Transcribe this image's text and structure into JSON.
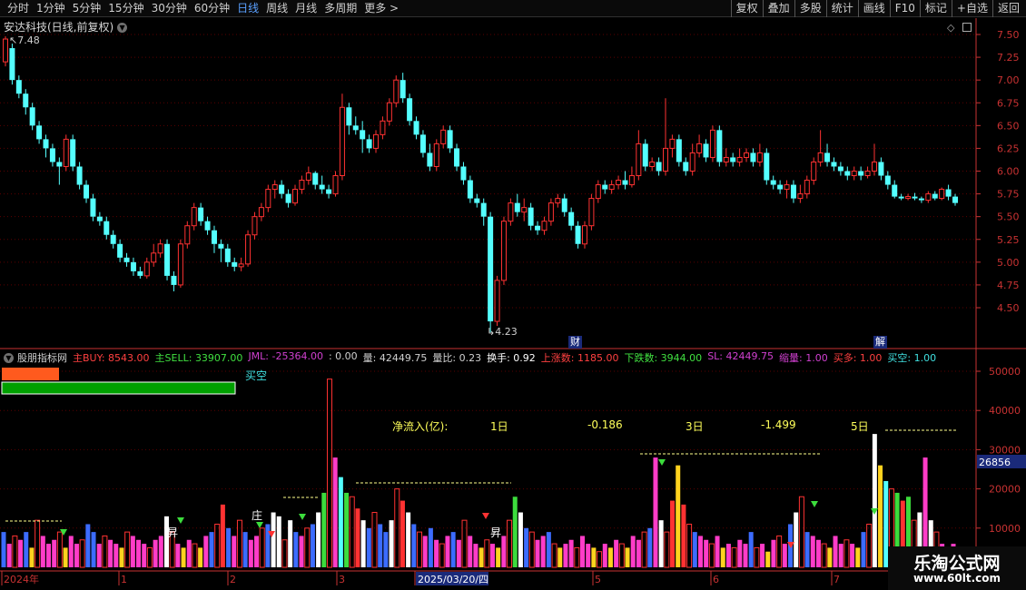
{
  "toolbar": {
    "left_items": [
      "分时",
      "1分钟",
      "5分钟",
      "15分钟",
      "30分钟",
      "60分钟",
      "日线",
      "周线",
      "月线",
      "多周期",
      "更多 >"
    ],
    "active_index": 6,
    "right_items": [
      "复权",
      "叠加",
      "多股",
      "统计",
      "画线",
      "F10",
      "标记",
      "+自选",
      "返回"
    ]
  },
  "main_chart": {
    "title": "安达科技(日线,前复权)",
    "high_label": "7.48",
    "low_label": "4.23",
    "events": [
      {
        "label": "财"
      },
      {
        "label": "解"
      }
    ],
    "price_axis": [
      "7.50",
      "7.25",
      "7.00",
      "6.75",
      "6.50",
      "6.25",
      "6.00",
      "5.75",
      "5.50",
      "5.25",
      "5.00",
      "4.75",
      "4.50"
    ],
    "candles": [
      [
        7.2,
        7.45,
        7.15,
        7.48
      ],
      [
        7.35,
        7.0,
        6.95,
        7.4
      ],
      [
        7.0,
        6.85,
        6.8,
        7.05
      ],
      [
        6.85,
        6.7,
        6.62,
        6.9
      ],
      [
        6.7,
        6.5,
        6.45,
        6.75
      ],
      [
        6.5,
        6.35,
        6.3,
        6.55
      ],
      [
        6.35,
        6.25,
        6.15,
        6.4
      ],
      [
        6.25,
        6.1,
        6.05,
        6.3
      ],
      [
        6.1,
        6.05,
        5.85,
        6.15
      ],
      [
        6.05,
        6.35,
        6.0,
        6.4
      ],
      [
        6.35,
        6.05,
        6.0,
        6.4
      ],
      [
        6.05,
        5.85,
        5.8,
        6.1
      ],
      [
        5.85,
        5.7,
        5.65,
        5.9
      ],
      [
        5.7,
        5.5,
        5.45,
        5.75
      ],
      [
        5.5,
        5.45,
        5.4,
        5.55
      ],
      [
        5.45,
        5.3,
        5.25,
        5.5
      ],
      [
        5.3,
        5.2,
        5.15,
        5.35
      ],
      [
        5.2,
        5.05,
        5.0,
        5.25
      ],
      [
        5.05,
        5.0,
        4.95,
        5.1
      ],
      [
        5.0,
        4.9,
        4.85,
        5.05
      ],
      [
        4.9,
        4.85,
        4.82,
        4.95
      ],
      [
        4.85,
        5.0,
        4.82,
        5.05
      ],
      [
        5.0,
        5.1,
        4.95,
        5.2
      ],
      [
        5.1,
        5.2,
        5.05,
        5.25
      ],
      [
        5.2,
        4.85,
        4.8,
        5.25
      ],
      [
        4.85,
        4.75,
        4.68,
        4.9
      ],
      [
        4.75,
        5.2,
        4.72,
        5.25
      ],
      [
        5.2,
        5.4,
        5.15,
        5.45
      ],
      [
        5.4,
        5.6,
        5.35,
        5.65
      ],
      [
        5.6,
        5.45,
        5.4,
        5.65
      ],
      [
        5.45,
        5.35,
        5.3,
        5.5
      ],
      [
        5.35,
        5.2,
        5.1,
        5.4
      ],
      [
        5.2,
        5.15,
        5.0,
        5.25
      ],
      [
        5.15,
        5.0,
        4.95,
        5.2
      ],
      [
        5.0,
        4.95,
        4.9,
        5.05
      ],
      [
        4.95,
        4.98,
        4.9,
        5.05
      ],
      [
        4.98,
        5.3,
        4.95,
        5.35
      ],
      [
        5.3,
        5.5,
        5.25,
        5.55
      ],
      [
        5.5,
        5.6,
        5.45,
        5.65
      ],
      [
        5.6,
        5.8,
        5.55,
        5.85
      ],
      [
        5.8,
        5.85,
        5.7,
        5.9
      ],
      [
        5.85,
        5.75,
        5.7,
        5.9
      ],
      [
        5.75,
        5.65,
        5.6,
        5.8
      ],
      [
        5.65,
        5.8,
        5.62,
        5.85
      ],
      [
        5.8,
        5.9,
        5.75,
        5.95
      ],
      [
        5.9,
        5.98,
        5.85,
        6.05
      ],
      [
        5.98,
        5.85,
        5.8,
        6.0
      ],
      [
        5.85,
        5.8,
        5.75,
        5.95
      ],
      [
        5.8,
        5.75,
        5.7,
        5.85
      ],
      [
        5.75,
        5.95,
        5.72,
        6.0
      ],
      [
        5.95,
        6.7,
        5.9,
        6.85
      ],
      [
        6.7,
        6.5,
        6.4,
        6.75
      ],
      [
        6.5,
        6.45,
        6.4,
        6.6
      ],
      [
        6.45,
        6.35,
        6.2,
        6.55
      ],
      [
        6.35,
        6.25,
        6.2,
        6.4
      ],
      [
        6.25,
        6.4,
        6.2,
        6.45
      ],
      [
        6.4,
        6.55,
        6.35,
        6.6
      ],
      [
        6.55,
        6.75,
        6.5,
        6.8
      ],
      [
        6.75,
        7.0,
        6.7,
        7.05
      ],
      [
        7.0,
        6.8,
        6.75,
        7.08
      ],
      [
        6.8,
        6.55,
        6.5,
        6.85
      ],
      [
        6.55,
        6.4,
        6.35,
        6.6
      ],
      [
        6.4,
        6.2,
        6.15,
        6.45
      ],
      [
        6.2,
        6.05,
        6.0,
        6.3
      ],
      [
        6.05,
        6.3,
        6.0,
        6.35
      ],
      [
        6.3,
        6.45,
        6.25,
        6.5
      ],
      [
        6.45,
        6.25,
        6.2,
        6.5
      ],
      [
        6.25,
        6.05,
        6.0,
        6.3
      ],
      [
        6.05,
        5.9,
        5.85,
        6.1
      ],
      [
        5.9,
        5.7,
        5.65,
        5.95
      ],
      [
        5.7,
        5.65,
        5.6,
        5.75
      ],
      [
        5.65,
        5.5,
        5.4,
        5.7
      ],
      [
        5.5,
        4.35,
        4.23,
        5.55
      ],
      [
        4.35,
        4.8,
        4.3,
        4.85
      ],
      [
        4.8,
        5.45,
        4.75,
        5.5
      ],
      [
        5.45,
        5.65,
        5.4,
        5.7
      ],
      [
        5.65,
        5.55,
        5.5,
        5.75
      ],
      [
        5.55,
        5.6,
        5.45,
        5.7
      ],
      [
        5.6,
        5.4,
        5.35,
        5.65
      ],
      [
        5.4,
        5.35,
        5.3,
        5.45
      ],
      [
        5.35,
        5.45,
        5.3,
        5.5
      ],
      [
        5.45,
        5.65,
        5.4,
        5.7
      ],
      [
        5.65,
        5.7,
        5.6,
        5.75
      ],
      [
        5.7,
        5.55,
        5.5,
        5.75
      ],
      [
        5.55,
        5.4,
        5.35,
        5.6
      ],
      [
        5.4,
        5.2,
        5.15,
        5.45
      ],
      [
        5.2,
        5.4,
        5.15,
        5.45
      ],
      [
        5.4,
        5.7,
        5.35,
        5.75
      ],
      [
        5.7,
        5.85,
        5.65,
        5.9
      ],
      [
        5.85,
        5.8,
        5.75,
        5.9
      ],
      [
        5.8,
        5.85,
        5.75,
        5.9
      ],
      [
        5.85,
        5.9,
        5.8,
        5.95
      ],
      [
        5.9,
        5.85,
        5.8,
        6.0
      ],
      [
        5.85,
        5.95,
        5.82,
        6.05
      ],
      [
        5.95,
        6.3,
        5.9,
        6.45
      ],
      [
        6.3,
        6.05,
        6.0,
        6.35
      ],
      [
        6.05,
        6.1,
        6.0,
        6.15
      ],
      [
        6.1,
        6.0,
        5.95,
        6.15
      ],
      [
        6.0,
        6.25,
        5.95,
        6.8
      ],
      [
        6.25,
        6.35,
        6.15,
        6.4
      ],
      [
        6.35,
        6.1,
        6.05,
        6.4
      ],
      [
        6.1,
        6.0,
        5.95,
        6.15
      ],
      [
        6.0,
        6.2,
        5.95,
        6.3
      ],
      [
        6.2,
        6.3,
        6.15,
        6.4
      ],
      [
        6.3,
        6.15,
        6.1,
        6.35
      ],
      [
        6.15,
        6.45,
        6.1,
        6.5
      ],
      [
        6.45,
        6.1,
        6.05,
        6.5
      ],
      [
        6.1,
        6.15,
        6.05,
        6.25
      ],
      [
        6.15,
        6.1,
        6.05,
        6.2
      ],
      [
        6.1,
        6.15,
        6.05,
        6.25
      ],
      [
        6.15,
        6.2,
        6.1,
        6.25
      ],
      [
        6.2,
        6.1,
        6.05,
        6.25
      ],
      [
        6.1,
        6.2,
        6.05,
        6.3
      ],
      [
        6.2,
        5.9,
        5.85,
        6.25
      ],
      [
        5.9,
        5.85,
        5.8,
        5.95
      ],
      [
        5.85,
        5.8,
        5.75,
        5.9
      ],
      [
        5.8,
        5.85,
        5.7,
        5.9
      ],
      [
        5.85,
        5.7,
        5.65,
        5.9
      ],
      [
        5.7,
        5.75,
        5.65,
        5.85
      ],
      [
        5.75,
        5.9,
        5.7,
        5.95
      ],
      [
        5.9,
        6.1,
        5.85,
        6.15
      ],
      [
        6.1,
        6.2,
        6.05,
        6.45
      ],
      [
        6.2,
        6.1,
        6.05,
        6.3
      ],
      [
        6.1,
        6.05,
        6.0,
        6.15
      ],
      [
        6.05,
        6.0,
        5.95,
        6.1
      ],
      [
        6.0,
        5.95,
        5.9,
        6.05
      ],
      [
        5.95,
        6.0,
        5.9,
        6.05
      ],
      [
        6.0,
        5.95,
        5.9,
        6.05
      ],
      [
        5.95,
        6.0,
        5.92,
        6.05
      ],
      [
        6.0,
        6.1,
        5.95,
        6.3
      ],
      [
        6.1,
        5.95,
        5.9,
        6.15
      ],
      [
        5.95,
        5.85,
        5.8,
        6.0
      ],
      [
        5.85,
        5.72,
        5.7,
        5.9
      ],
      [
        5.72,
        5.7,
        5.68,
        5.75
      ],
      [
        5.7,
        5.72,
        5.68,
        5.75
      ],
      [
        5.72,
        5.7,
        5.68,
        5.76
      ],
      [
        5.7,
        5.68,
        5.65,
        5.72
      ],
      [
        5.68,
        5.75,
        5.65,
        5.78
      ],
      [
        5.75,
        5.7,
        5.68,
        5.78
      ],
      [
        5.7,
        5.8,
        5.68,
        5.82
      ],
      [
        5.8,
        5.72,
        5.68,
        5.85
      ],
      [
        5.72,
        5.65,
        5.62,
        5.75
      ]
    ]
  },
  "indicator": {
    "name": "股朋指标网",
    "fields": [
      {
        "text": "主BUY: 8543.00",
        "color": "#ff4040"
      },
      {
        "text": "主SELL: 33907.00",
        "color": "#40e040"
      },
      {
        "text": "JML: -25364.00",
        "color": "#d040d0"
      },
      {
        "text": ": 0.00",
        "color": "#d0d0d0"
      },
      {
        "text": "量: 42449.75",
        "color": "#d0d0d0"
      },
      {
        "text": "量比: 0.23",
        "color": "#d0d0d0"
      },
      {
        "text": "换手: 0.92",
        "color": "#ffffff"
      },
      {
        "text": "上涨数: 1185.00",
        "color": "#ff4040"
      },
      {
        "text": "下跌数: 3944.00",
        "color": "#40e040"
      },
      {
        "text": "SL: 42449.75",
        "color": "#d040d0"
      },
      {
        "text": "缩量: 1.00",
        "color": "#d040d0"
      },
      {
        "text": "买多: 1.00",
        "color": "#ff4040"
      },
      {
        "text": "买空: 1.00",
        "color": "#40e0e0"
      }
    ],
    "buy_sell_label": "买空",
    "buy_ratio": 0.2,
    "net_inflow": {
      "label": "净流入(亿):",
      "d1_label": "1日",
      "d1_value": "-0.186",
      "d3_label": "3日",
      "d3_value": "-1.499",
      "d5_label": "5日"
    },
    "axis": [
      "50000",
      "40000",
      "30000",
      "20000",
      "10000"
    ],
    "current_value": "26856",
    "markers": [
      {
        "label": "昇"
      },
      {
        "label": "庄"
      },
      {
        "label": "昇"
      }
    ],
    "volumes": [
      9000,
      6000,
      8000,
      7000,
      9000,
      5000,
      12000,
      8000,
      6000,
      7000,
      9000,
      5000,
      8000,
      6000,
      7000,
      11000,
      9000,
      6000,
      8000,
      7000,
      6000,
      5000,
      9000,
      8000,
      7000,
      6000,
      5000,
      7000,
      8000,
      13000,
      9000,
      6000,
      5000,
      7000,
      6000,
      5000,
      8000,
      9000,
      11000,
      16000,
      10000,
      8000,
      12000,
      9000,
      7000,
      8000,
      10000,
      11000,
      14000,
      13000,
      7000,
      12000,
      9000,
      8000,
      10000,
      11000,
      14000,
      19000,
      48000,
      28000,
      23000,
      19000,
      18000,
      15000,
      12000,
      10000,
      14000,
      11000,
      9000,
      12000,
      20000,
      17000,
      14000,
      11000,
      9000,
      8000,
      10000,
      7000,
      6000,
      8000,
      9000,
      7000,
      12000,
      8000,
      6000,
      5000,
      7000,
      6000,
      5000,
      8000,
      12000,
      18000,
      14000,
      10000,
      9000,
      7000,
      8000,
      9000,
      6000,
      5000,
      6000,
      7000,
      5000,
      8000,
      6000,
      5000,
      4000,
      6000,
      5000,
      7000,
      6000,
      5000,
      8000,
      7000,
      9000,
      10000,
      28000,
      12000,
      9000,
      17000,
      26000,
      16000,
      11000,
      9000,
      8000,
      7000,
      6000,
      8000,
      5000,
      6000,
      5000,
      7000,
      6000,
      9000,
      5000,
      6000,
      4000,
      7000,
      8000,
      6000,
      11000,
      14000,
      18000,
      9000,
      8000,
      7000,
      6000,
      5000,
      8000,
      6000,
      7000,
      6000,
      5000,
      9000,
      11000,
      34000,
      26000,
      22000,
      20000,
      19000,
      17000,
      18000,
      12000,
      14000,
      28000,
      12000,
      9000,
      6000,
      5000,
      6000
    ]
  },
  "date_axis": {
    "labels": [
      "2024年",
      "1",
      "2",
      "3",
      "2025/03/20/四",
      "5",
      "6",
      "7"
    ]
  },
  "watermark": {
    "name": "乐淘公式网",
    "url": "www.60lt.com"
  },
  "colors": {
    "up": "#ff3232",
    "down": "#54ffff",
    "grid": "#5a0000",
    "axis": "#c83232",
    "buy": "#ff5a1e",
    "sell": "#00a000"
  }
}
